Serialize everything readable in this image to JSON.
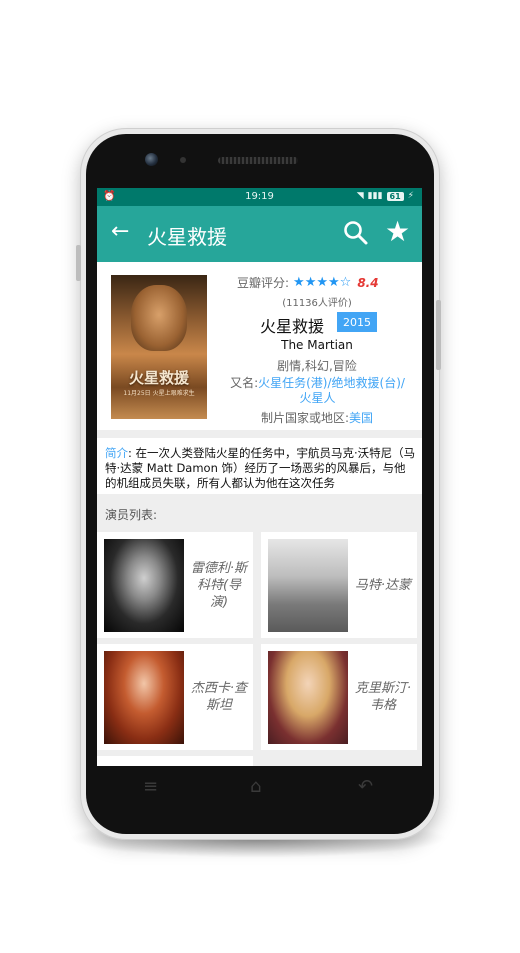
{
  "status": {
    "time": "19:19",
    "battery": "61"
  },
  "appbar": {
    "back_icon": "arrow-left",
    "title": "火星救援",
    "search_icon": "magnifier",
    "favorite_icon": "star"
  },
  "movie": {
    "rating_label": "豆瓣评分:",
    "stars": "★★★★☆",
    "score": "8.4",
    "rating_count": "(11136人评价)",
    "title_cn": "火星救援",
    "year": "2015",
    "title_en": "The Martian",
    "genres": "剧情,科幻,冒险",
    "aka_label": "又名:",
    "aka_value": "火星任务(港)/绝地救援(台)/火星人",
    "country_label": "制片国家或地区:",
    "country_value": "美国",
    "poster": {
      "title": "火星救援",
      "subtitle": "11月25日 火星上艰难求生"
    }
  },
  "summary": {
    "label": "简介",
    "text": ": 在一次人类登陆火星的任务中，宇航员马克·沃特尼（马特·达蒙 Matt Damon 饰）经历了一场恶劣的风暴后，与他的机组成员失联，所有人都认为他在这次任务"
  },
  "cast": {
    "header": "演员列表:",
    "members": [
      {
        "name": "雷德利·斯科特(导演)"
      },
      {
        "name": "马特·达蒙"
      },
      {
        "name": "杰西卡·查斯坦"
      },
      {
        "name": "克里斯汀·韦格"
      }
    ]
  },
  "nav": {
    "menu_icon": "≡",
    "home_icon": "⌂",
    "back_icon": "↶"
  },
  "colors": {
    "statusbar": "#00796b",
    "appbar": "#26a69a",
    "accent_blue": "#42a5f5",
    "score_red": "#e53935"
  }
}
